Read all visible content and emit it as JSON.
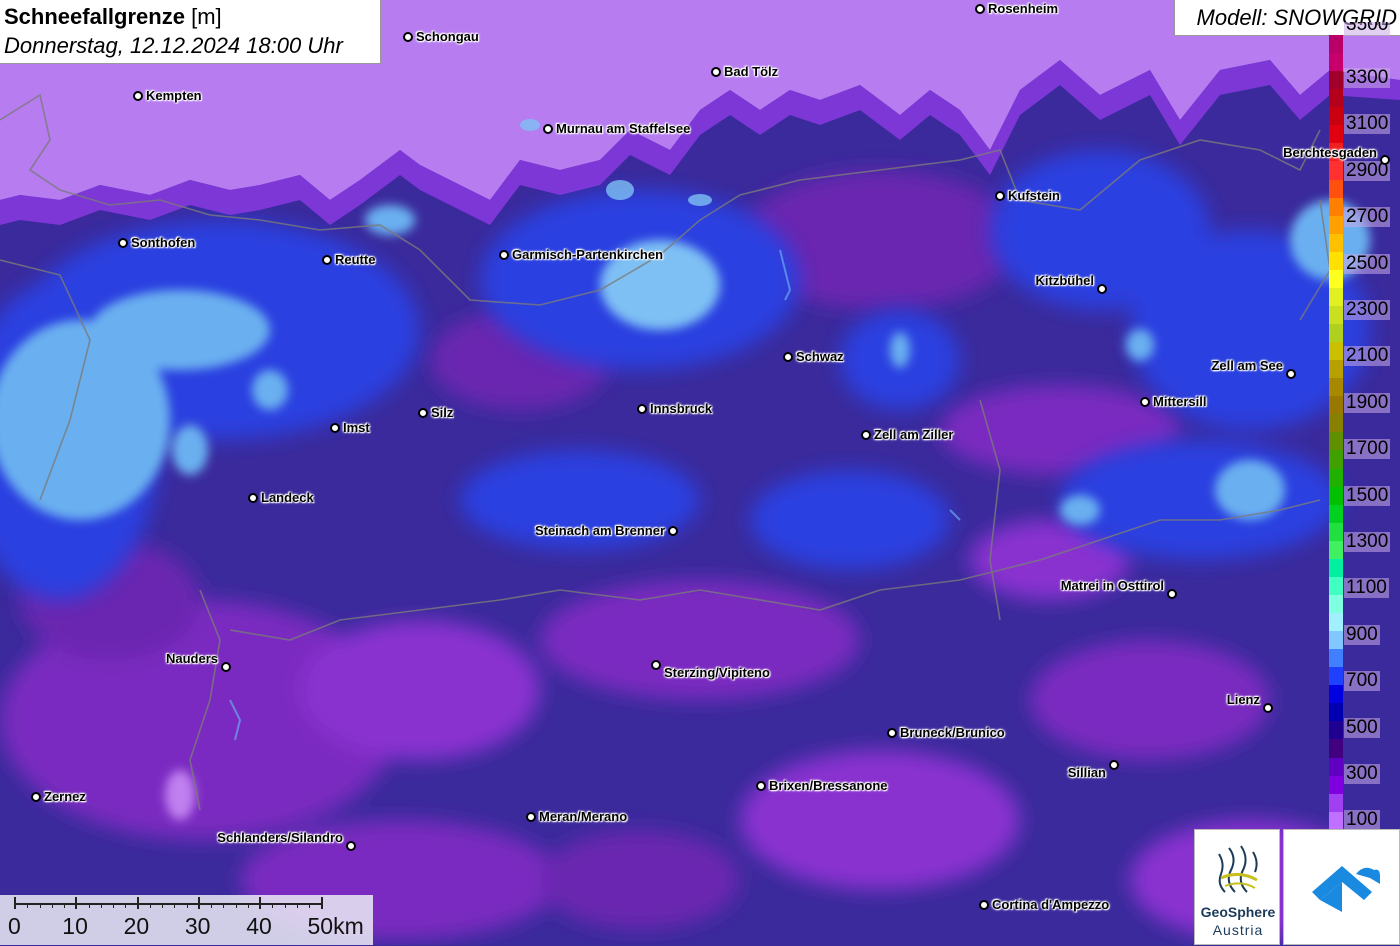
{
  "title": {
    "parameter": "Schneefallgrenze",
    "unit": "[m]",
    "datetime": "Donnerstag, 12.12.2024 18:00 Uhr"
  },
  "model": "Modell: SNOWGRID",
  "legend": {
    "labels": [
      "3300",
      "3100",
      "2900",
      "2700",
      "2500",
      "2300",
      "2100",
      "1900",
      "1700",
      "1500",
      "1300",
      "1100",
      "900",
      "700",
      "500",
      "300",
      "100"
    ],
    "top_partial_label": "3500",
    "colors": [
      "#b80068",
      "#c8006e",
      "#a0002a",
      "#b4001a",
      "#c80010",
      "#e00010",
      "#f02020",
      "#ff3030",
      "#ff5010",
      "#ff8000",
      "#ffa000",
      "#ffc000",
      "#ffe000",
      "#ffff20",
      "#e0f020",
      "#c8e020",
      "#b0d020",
      "#c8c000",
      "#b8a000",
      "#a88800",
      "#987800",
      "#888000",
      "#609000",
      "#40a000",
      "#20b000",
      "#00c000",
      "#00d020",
      "#20e040",
      "#40f060",
      "#00f0a0",
      "#40ffc0",
      "#80ffe0",
      "#a0f0ff",
      "#80c8ff",
      "#4080ff",
      "#2040ff",
      "#0000e0",
      "#0000b0",
      "#200090",
      "#400080",
      "#6000c0",
      "#8000e0",
      "#a040f0",
      "#c070ff"
    ]
  },
  "cities": [
    {
      "name": "Rosenheim"
    },
    {
      "name": "Schongau"
    },
    {
      "name": "Kempten"
    },
    {
      "name": "Bad Tölz"
    },
    {
      "name": "Murnau am Staffelsee"
    },
    {
      "name": "Berchtesgaden"
    },
    {
      "name": "Kufstein"
    },
    {
      "name": "Sonthofen"
    },
    {
      "name": "Reutte"
    },
    {
      "name": "Garmisch-Partenkirchen"
    },
    {
      "name": "Kitzbühel"
    },
    {
      "name": "Schwaz"
    },
    {
      "name": "Zell am See"
    },
    {
      "name": "Mittersill"
    },
    {
      "name": "Silz"
    },
    {
      "name": "Innsbruck"
    },
    {
      "name": "Imst"
    },
    {
      "name": "Zell am Ziller"
    },
    {
      "name": "Landeck"
    },
    {
      "name": "Steinach am Brenner"
    },
    {
      "name": "Matrei in Osttirol"
    },
    {
      "name": "Nauders"
    },
    {
      "name": "Sterzing/Vipiteno"
    },
    {
      "name": "Lienz"
    },
    {
      "name": "Bruneck/Brunico"
    },
    {
      "name": "Sillian"
    },
    {
      "name": "Brixen/Bressanone"
    },
    {
      "name": "Zernez"
    },
    {
      "name": "Meran/Merano"
    },
    {
      "name": "Schlanders/Silandro"
    },
    {
      "name": "Cortina d'Ampezzo"
    }
  ],
  "scale": {
    "labels": [
      "0",
      "10",
      "20",
      "30",
      "40",
      "50km"
    ]
  },
  "logos": {
    "geosphere_name": "GeoSphere",
    "geosphere_sub": "Austria"
  }
}
